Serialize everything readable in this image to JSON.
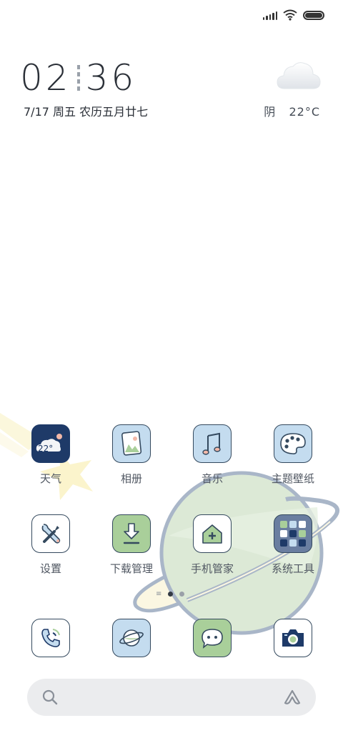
{
  "status_bar": {
    "icons": [
      "signal-icon",
      "wifi-icon",
      "battery-icon"
    ]
  },
  "clock": {
    "hours": "02",
    "minutes": "36"
  },
  "date_line": "7/17 周五 农历五月廿七",
  "weather": {
    "condition": "阴",
    "temperature": "22°C",
    "icon": "cloud-icon"
  },
  "apps_row1": [
    {
      "label": "天气",
      "icon": "weather-app-icon",
      "icon_text": "22°"
    },
    {
      "label": "相册",
      "icon": "gallery-icon"
    },
    {
      "label": "音乐",
      "icon": "music-icon"
    },
    {
      "label": "主题壁纸",
      "icon": "palette-icon"
    }
  ],
  "apps_row2": [
    {
      "label": "设置",
      "icon": "tools-icon"
    },
    {
      "label": "下载管理",
      "icon": "download-icon"
    },
    {
      "label": "手机管家",
      "icon": "home-plus-icon"
    },
    {
      "label": "系统工具",
      "icon": "folder-icon"
    }
  ],
  "dock": [
    {
      "icon": "phone-icon"
    },
    {
      "icon": "browser-planet-icon"
    },
    {
      "icon": "message-icon"
    },
    {
      "icon": "camera-icon"
    }
  ],
  "page_indicator": {
    "pages": 2,
    "current": 1,
    "menu_glyph": "≡"
  },
  "search": {
    "icon": "search-icon",
    "assistant_icon": "assistant-icon"
  },
  "colors": {
    "navy": "#1e3a68",
    "light_blue": "#c4dcef",
    "green": "#a9cf9a",
    "planet": "#dce9d6"
  }
}
